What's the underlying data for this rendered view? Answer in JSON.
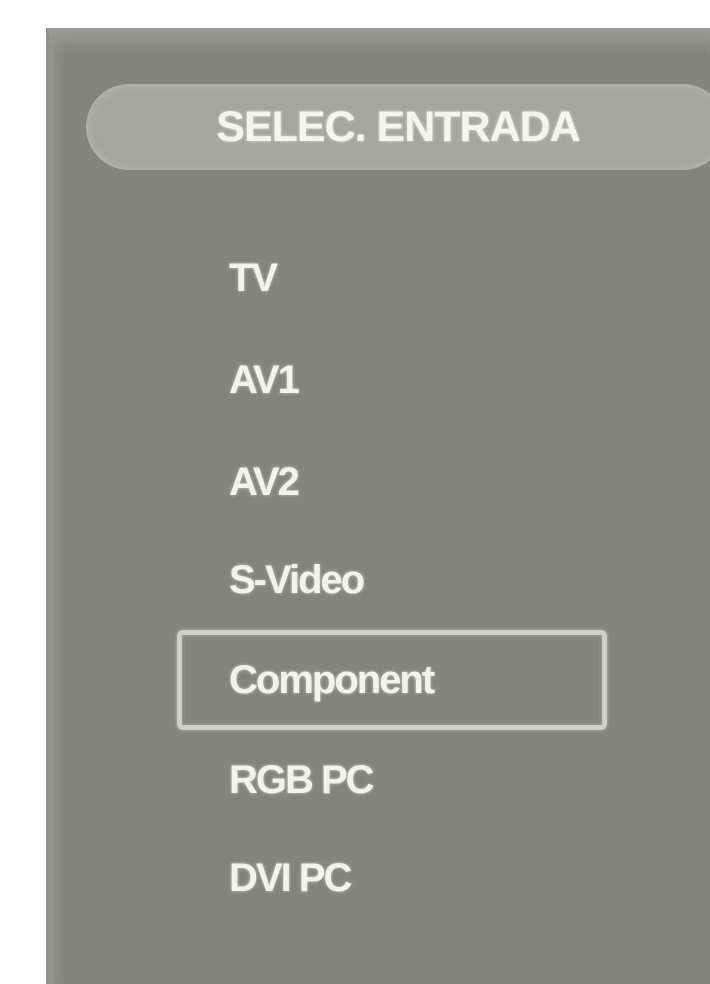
{
  "menu": {
    "title": "SELEC. ENTRADA",
    "items": [
      {
        "label": "TV",
        "selected": false
      },
      {
        "label": "AV1",
        "selected": false
      },
      {
        "label": "AV2",
        "selected": false
      },
      {
        "label": "S-Video",
        "selected": false
      },
      {
        "label": "Component",
        "selected": true
      },
      {
        "label": "RGB PC",
        "selected": false
      },
      {
        "label": "DVI PC",
        "selected": false
      }
    ]
  },
  "colors": {
    "panel_background": "#838381",
    "header_pill": "#a5a5a3",
    "text": "#f2f2f0",
    "selection_border": "#cfcfcd"
  }
}
